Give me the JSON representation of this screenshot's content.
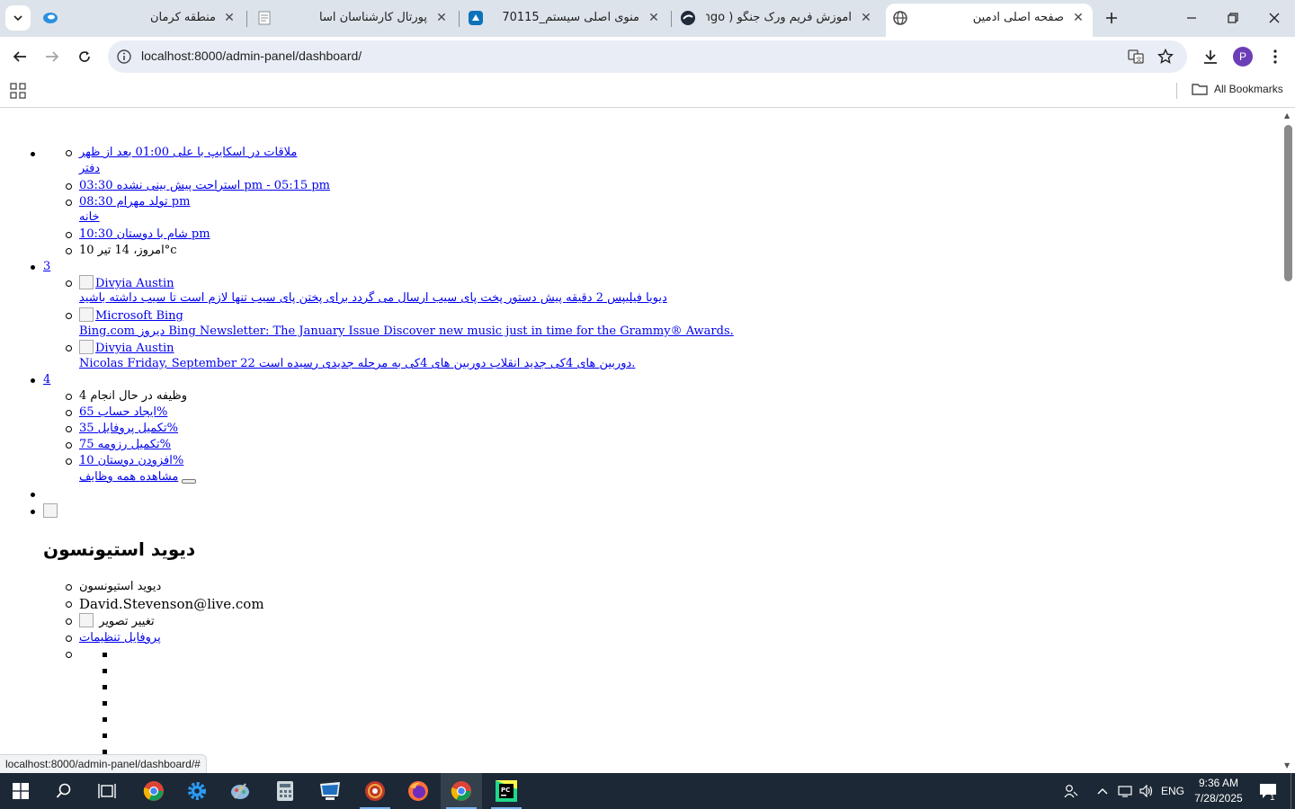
{
  "browser": {
    "tabs": [
      {
        "title": "منطقه کرمان",
        "active": false
      },
      {
        "title": "پورتال کارشناسان آسا",
        "active": false
      },
      {
        "title": "منوی اصلی سیستم_70115",
        "active": false
      },
      {
        "title": "آموزش فریم ورک جنگو ( Django",
        "active": false
      },
      {
        "title": "صفحه اصلی ادمین",
        "active": true
      }
    ],
    "url": "localhost:8000/admin-panel/dashboard/",
    "profile_initial": "P",
    "all_bookmarks_label": "All Bookmarks",
    "status_url": "localhost:8000/admin-panel/dashboard/#"
  },
  "page": {
    "schedule": {
      "items": [
        {
          "text": "ملاقات در اسکایپ با علی 01:00 بعد از ظهر"
        },
        {
          "text": "دفتر"
        },
        {
          "text": "استراحت پیش بینی نشده 03:30 pm - 05:15 pm"
        },
        {
          "text": "تولد مهرام 08:30 pm"
        },
        {
          "text": "خانه"
        },
        {
          "text": "شام با دوستان 10:30 pm"
        }
      ],
      "today": "امروز، 14 تیر 10°c"
    },
    "messages": {
      "count": "3",
      "items": [
        {
          "img_alt": "Divyia Austin",
          "text": "دیویا فیلیپس 2 دقیقه پیش دستور پخت پای سیب ارسال می گردد برای پختن پای سیب تنها لازم است تا سیب داشته باشید"
        },
        {
          "img_alt": "Microsoft Bing",
          "text": "Bing.com دیروز Bing Newsletter: The January Issue Discover new music just in time for the Grammy® Awards."
        },
        {
          "img_alt": "Divyia Austin",
          "text": "Nicolas Friday, September 22 دوربین های 4کی جدید انقلاب دوربین های 4کی به مرحله جدیدی رسیده است."
        }
      ]
    },
    "tasks": {
      "count": "4",
      "header": "وظیفه در حال انجام 4",
      "items": [
        {
          "text": "ایجاد حساب 65%"
        },
        {
          "text": "تکمیل پروفایل 35%"
        },
        {
          "text": "تکمیل رزومه 75%"
        },
        {
          "text": "افزودن دوستان 10%"
        }
      ],
      "view_all": "مشاهده همه وظایف"
    },
    "user": {
      "name": "دیوید استیونسون",
      "name_small": "دیوید استیونسون",
      "email": "David.Stevenson@live.com",
      "change_photo": "تغییر تصویر",
      "profile_settings": "پروفایل تنظیمات"
    }
  },
  "taskbar": {
    "lang": "ENG",
    "time": "9:36 AM",
    "date": "7/28/2025",
    "notification_count": "1"
  },
  "colors": {
    "tabstrip": "#dde3ea",
    "omnibox": "#e9eef6",
    "link": "#0000ee",
    "taskbar": "#1c2836"
  }
}
